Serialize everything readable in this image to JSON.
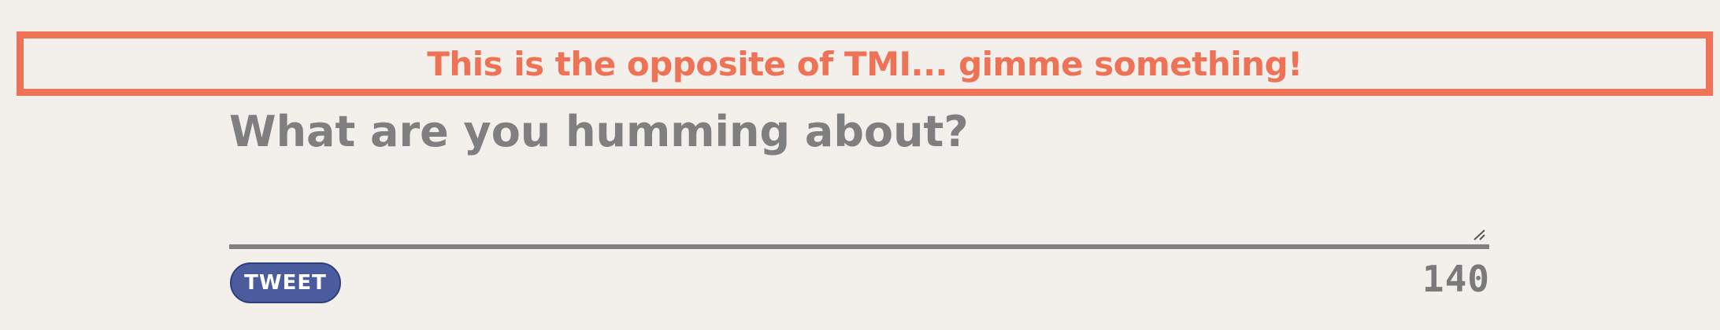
{
  "error": {
    "message": "This is the opposite of TMI... gimme something!"
  },
  "compose": {
    "placeholder": "What are you humming about?",
    "value": ""
  },
  "actions": {
    "tweet_label": "TWEET"
  },
  "counter": {
    "remaining": "140"
  },
  "colors": {
    "background": "#f3f0ec",
    "error": "#ee7256",
    "text_muted": "#7f7f7f",
    "button": "#4a5b9e",
    "button_text": "#ffffff"
  }
}
